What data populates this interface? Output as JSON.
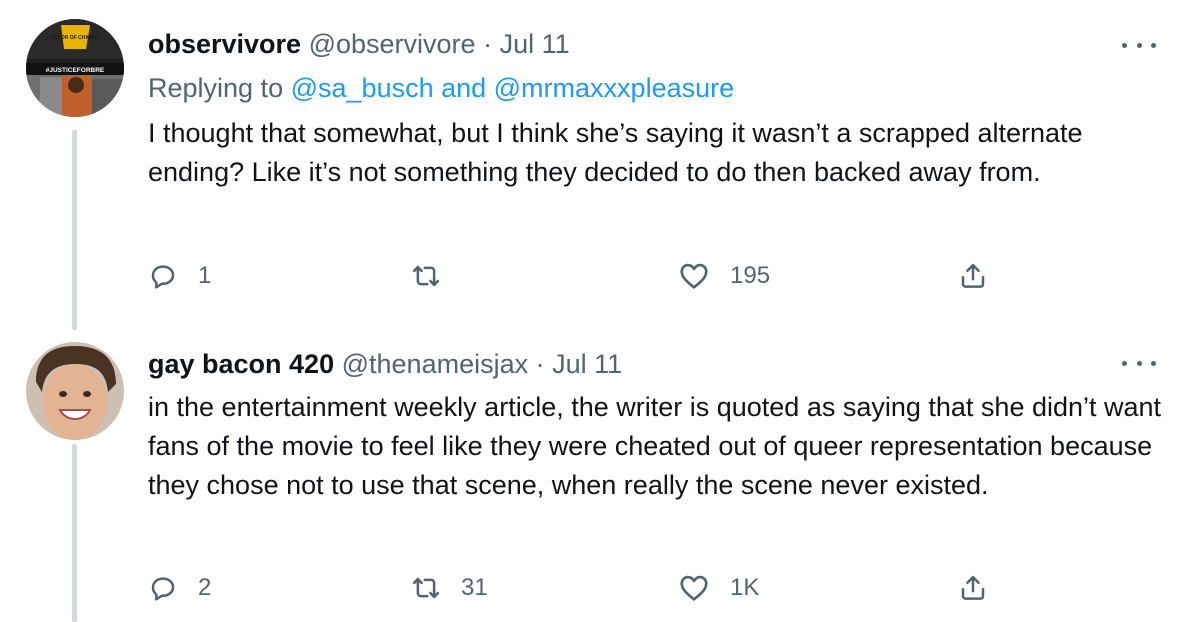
{
  "tweets": [
    {
      "display_name": "observivore",
      "handle": "@observivore",
      "separator": "·",
      "date": "Jul 11",
      "replying_prefix": "Replying to",
      "replying_users": "@sa_busch and @mrmaxxxpleasure",
      "avatar_text": {
        "logo_top": "COLOR OF CHANGE",
        "tag": "#JUSTICEFORBRE"
      },
      "text": "I thought that somewhat, but I think she’s saying it wasn’t a scrapped alternate ending? Like it’s not something they decided to do then backed away from.",
      "reply_count": "1",
      "retweet_count": "",
      "like_count": "195",
      "icons": {
        "reply": "reply-icon",
        "retweet": "retweet-icon",
        "like": "heart-icon",
        "share": "share-icon",
        "more": "more-options-icon"
      }
    },
    {
      "display_name": "gay bacon 420",
      "handle": "@thenameisjax",
      "separator": "·",
      "date": "Jul 11",
      "text": "in the entertainment weekly article, the writer is quoted as saying that she didn’t want fans of the movie to feel like they were cheated out of queer representation because they chose not to use that scene, when really the scene never existed.",
      "reply_count": "2",
      "retweet_count": "31",
      "like_count": "1K",
      "icons": {
        "reply": "reply-icon",
        "retweet": "retweet-icon",
        "like": "heart-icon",
        "share": "share-icon",
        "more": "more-options-icon"
      }
    }
  ],
  "colors": {
    "text_primary": "#0f1419",
    "text_secondary": "#536471",
    "link": "#1d9bf0",
    "thread_line": "#cfd9de"
  }
}
